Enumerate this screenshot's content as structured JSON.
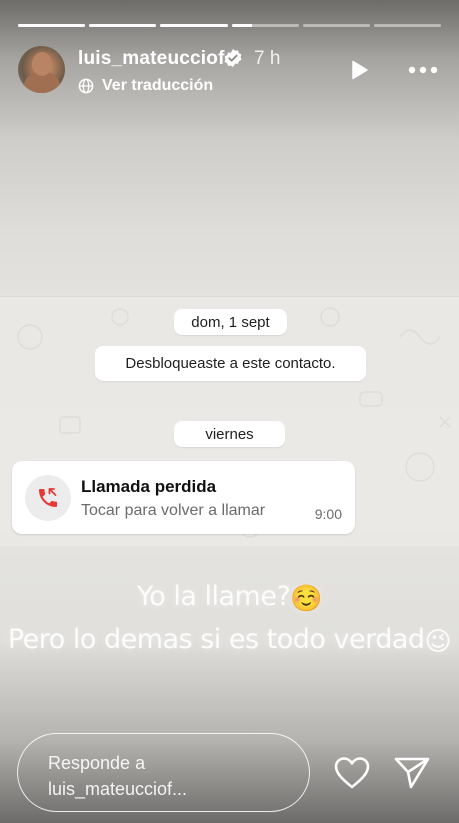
{
  "story": {
    "segments": [
      1,
      1,
      1,
      0.3,
      0,
      0
    ]
  },
  "header": {
    "username": "luis_mateucciof",
    "time_ago": "7 h",
    "translate_label": "Ver traducción"
  },
  "chat": {
    "date_label_1": "dom, 1 sept",
    "system_message": "Desbloqueaste a este contacto.",
    "date_label_2": "viernes",
    "missed_call": {
      "title": "Llamada perdida",
      "subtitle": "Tocar para volver a llamar",
      "time": "9:00"
    }
  },
  "captions": {
    "line1_text": "Yo la llame?",
    "line1_emoji": "☺️",
    "line2_text": "Pero lo demas si es todo verdad",
    "line2_emoji": "😉"
  },
  "footer": {
    "reply_placeholder": "Responde a luis_mateucciof..."
  },
  "colors": {
    "missed_call_red": "#e53935",
    "verified_blue": "#ffffff"
  },
  "icons": {
    "verified": "verified-badge-icon",
    "globe": "globe-icon",
    "play": "play-icon",
    "more": "more-options-icon",
    "missed_call": "missed-call-icon",
    "heart": "heart-icon",
    "send": "send-icon"
  }
}
